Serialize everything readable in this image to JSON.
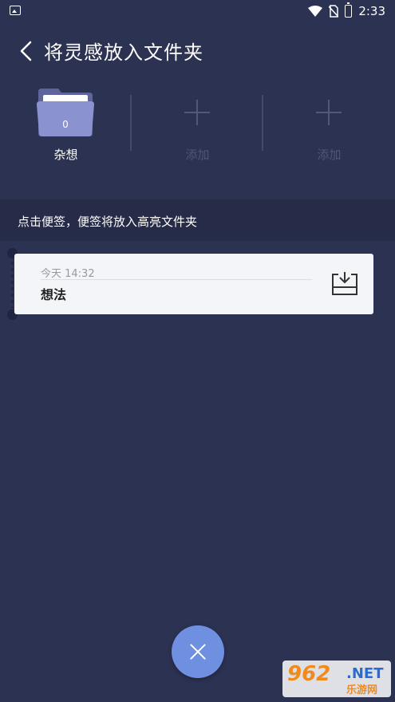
{
  "status_bar": {
    "time": "2:33",
    "icons": [
      "image-icon",
      "wifi-icon",
      "no-sim-icon",
      "battery-charging-icon"
    ]
  },
  "header": {
    "back_icon": "chevron-left-icon",
    "title": "将灵感放入文件夹"
  },
  "folders": [
    {
      "label": "杂想",
      "count": "0",
      "icon": "folder-icon"
    },
    {
      "label": "添加",
      "icon": "plus-icon"
    },
    {
      "label": "添加",
      "icon": "plus-icon"
    }
  ],
  "hint": "点击便签，便签将放入高亮文件夹",
  "notes": [
    {
      "date": "今天  14:32",
      "title": "想法",
      "action_icon": "move-to-folder-icon"
    }
  ],
  "fab": {
    "icon": "close-icon"
  },
  "watermark": {
    "logo": "962",
    "domain": ".NET",
    "sub": "乐游网"
  },
  "colors": {
    "background": "#2c3252",
    "hint_bar": "#262b47",
    "card": "#f4f5f9",
    "fab": "#6f8fe0",
    "folder": "#8a93cf"
  }
}
